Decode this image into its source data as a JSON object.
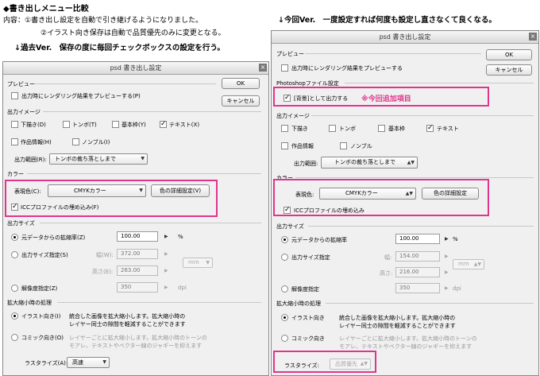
{
  "header": {
    "title": "◆書き出しメニュー比較",
    "content_line1": "内容：①書き出し設定を自動で引き継げるようになりました。",
    "content_line2": "②イラスト向き保存は自動で品質優先のみに変更となる。",
    "left_caption": "↓過去Ver.　保存の度に毎回チェックボックスの設定を行う。",
    "right_caption": "↓今回Ver.　一度設定すれば何度も設定し直さなくて良くなる。"
  },
  "old_dialog": {
    "title": "psd 書き出し設定",
    "close": "×",
    "ok": "OK",
    "cancel": "キャンセル",
    "preview_section": "プレビュー",
    "preview_check": "出力時にレンダリング結果をプレビューする(P)",
    "image_section": "出力イメージ",
    "opts": {
      "draft": "下描き(D)",
      "tombo": "トンボ(T)",
      "frame": "基本枠(Y)",
      "text": "テキスト(X)",
      "workinfo": "作品情報(H)",
      "nombre": "ノンブル(I)"
    },
    "range_label": "出力範囲(R):",
    "range_value": "トンボの裁ち落としまで",
    "color_section": "カラー",
    "expr_label": "表現色(C):",
    "expr_value": "CMYKカラー",
    "color_detail": "色の詳細設定(V)",
    "icc": "ICCプロファイルの埋め込み(F)",
    "size_section": "出力サイズ",
    "scale_label": "元データからの拡縮率(Z)",
    "scale_value": "100.00",
    "scale_unit": "%",
    "outsize_label": "出力サイズ指定(S)",
    "width_label": "幅(W):",
    "width_value": "372.00",
    "height_label": "高さ(E):",
    "height_value": "263.00",
    "unit": "mm",
    "res_label": "解像度指定(Z)",
    "res_value": "350",
    "res_unit": "dpi",
    "scaling_section": "拡大縮小時の処理",
    "illust_label": "イラスト向き(I)",
    "illust_desc1": "統合した画像を拡大縮小します。拡大縮小時の",
    "illust_desc2": "レイヤー同士の隙間を軽減することができます",
    "comic_label": "コミック向き(O)",
    "comic_desc1": "レイヤーごとに拡大縮小します。拡大縮小時のトーンの",
    "comic_desc2": "モアレ、テキストやベクター線のジャギーを抑えます",
    "rasterize_label": "ラスタライズ(A):",
    "rasterize_value": "高速"
  },
  "new_dialog": {
    "title": "psd 書き出し設定",
    "close": "×",
    "ok": "OK",
    "cancel": "キャンセル",
    "preview_section": "プレビュー",
    "preview_check": "出力時にレンダリング結果をプレビューする",
    "ps_section": "Photoshopファイル設定",
    "bg_check": "[背景]として出力する",
    "new_item": "※今回追加項目",
    "image_section": "出力イメージ",
    "opts": {
      "draft": "下描き",
      "tombo": "トンボ",
      "frame": "基本枠",
      "text": "テキスト",
      "workinfo": "作品情報",
      "nombre": "ノンブル"
    },
    "range_label": "出力範囲:",
    "range_value": "トンボの裁ち落としまで",
    "color_section": "カラー",
    "expr_label": "表現色:",
    "expr_value": "CMYKカラー",
    "color_detail": "色の詳細設定",
    "icc": "ICCプロファイルの埋め込み",
    "size_section": "出力サイズ",
    "scale_label": "元データからの拡縮率",
    "scale_value": "100.00",
    "scale_unit": "%",
    "outsize_label": "出力サイズ指定",
    "width_label": "幅:",
    "width_value": "154.00",
    "height_label": "高さ:",
    "height_value": "216.00",
    "unit": "mm",
    "res_label": "解像度指定",
    "res_value": "350",
    "res_unit": "dpi",
    "scaling_section": "拡大縮小時の処理",
    "illust_label": "イラスト向き",
    "illust_desc1": "統合した画像を拡大縮小します。拡大縮小時の",
    "illust_desc2": "レイヤー同士の隙間を軽減することができます",
    "comic_label": "コミック向き",
    "comic_desc1": "レイヤーごとに拡大縮小します。拡大縮小時のトーンの",
    "comic_desc2": "モアレ、テキストやベクター線のジャギーを抑えます",
    "rasterize_label": "ラスタライズ:",
    "rasterize_value": "品質優先"
  },
  "colors": {
    "highlight": "#e0358e",
    "note_text": "#e0358e"
  }
}
